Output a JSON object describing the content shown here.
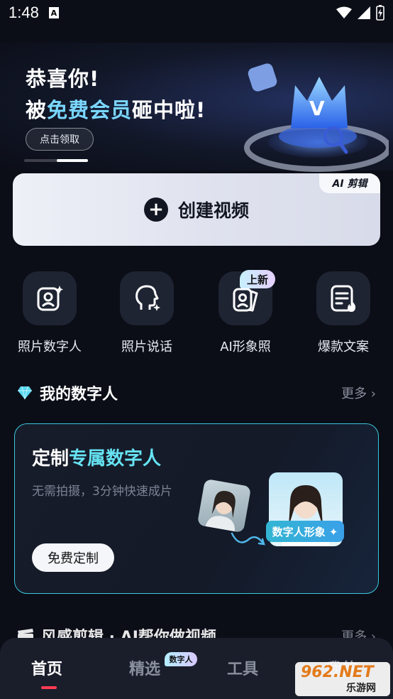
{
  "status_bar": {
    "time": "1:48",
    "notif_letter": "A"
  },
  "banner": {
    "line1": "恭喜你!",
    "line2_prefix": "被",
    "line2_highlight": "免费会员",
    "line2_suffix": "砸中啦!",
    "button": "点击领取",
    "crown_letter": "V"
  },
  "create": {
    "label": "创建视频",
    "tag": "AI 剪辑"
  },
  "features": [
    {
      "label": "照片数字人",
      "icon": "photo-person-sparkle-icon"
    },
    {
      "label": "照片说话",
      "icon": "talking-head-icon"
    },
    {
      "label": "AI形象照",
      "icon": "ai-portrait-icon",
      "badge": "上新"
    },
    {
      "label": "爆款文案",
      "icon": "document-fire-icon"
    }
  ],
  "my_digital_human": {
    "title": "我的数字人",
    "more": "更多 ›",
    "card": {
      "title_prefix": "定制",
      "title_highlight": "专属数字人",
      "subtitle": "无需拍摄，3分钟快速成片",
      "button": "免费定制",
      "chip": "数字人形象 ✦"
    }
  },
  "next_section": {
    "title": "风感剪辑 · AI帮你做视频",
    "more": "更多 ›"
  },
  "bottom_nav": {
    "items": [
      "首页",
      "精选",
      "工具",
      "我的"
    ],
    "active": "首页",
    "badge": "数字人"
  },
  "watermark": {
    "top": "962.NET",
    "bottom": "乐游网"
  },
  "colors": {
    "accent_cyan": "#66e3f3",
    "card_border": "#3bc7dc",
    "nav_active_line": "#ff3b53"
  }
}
